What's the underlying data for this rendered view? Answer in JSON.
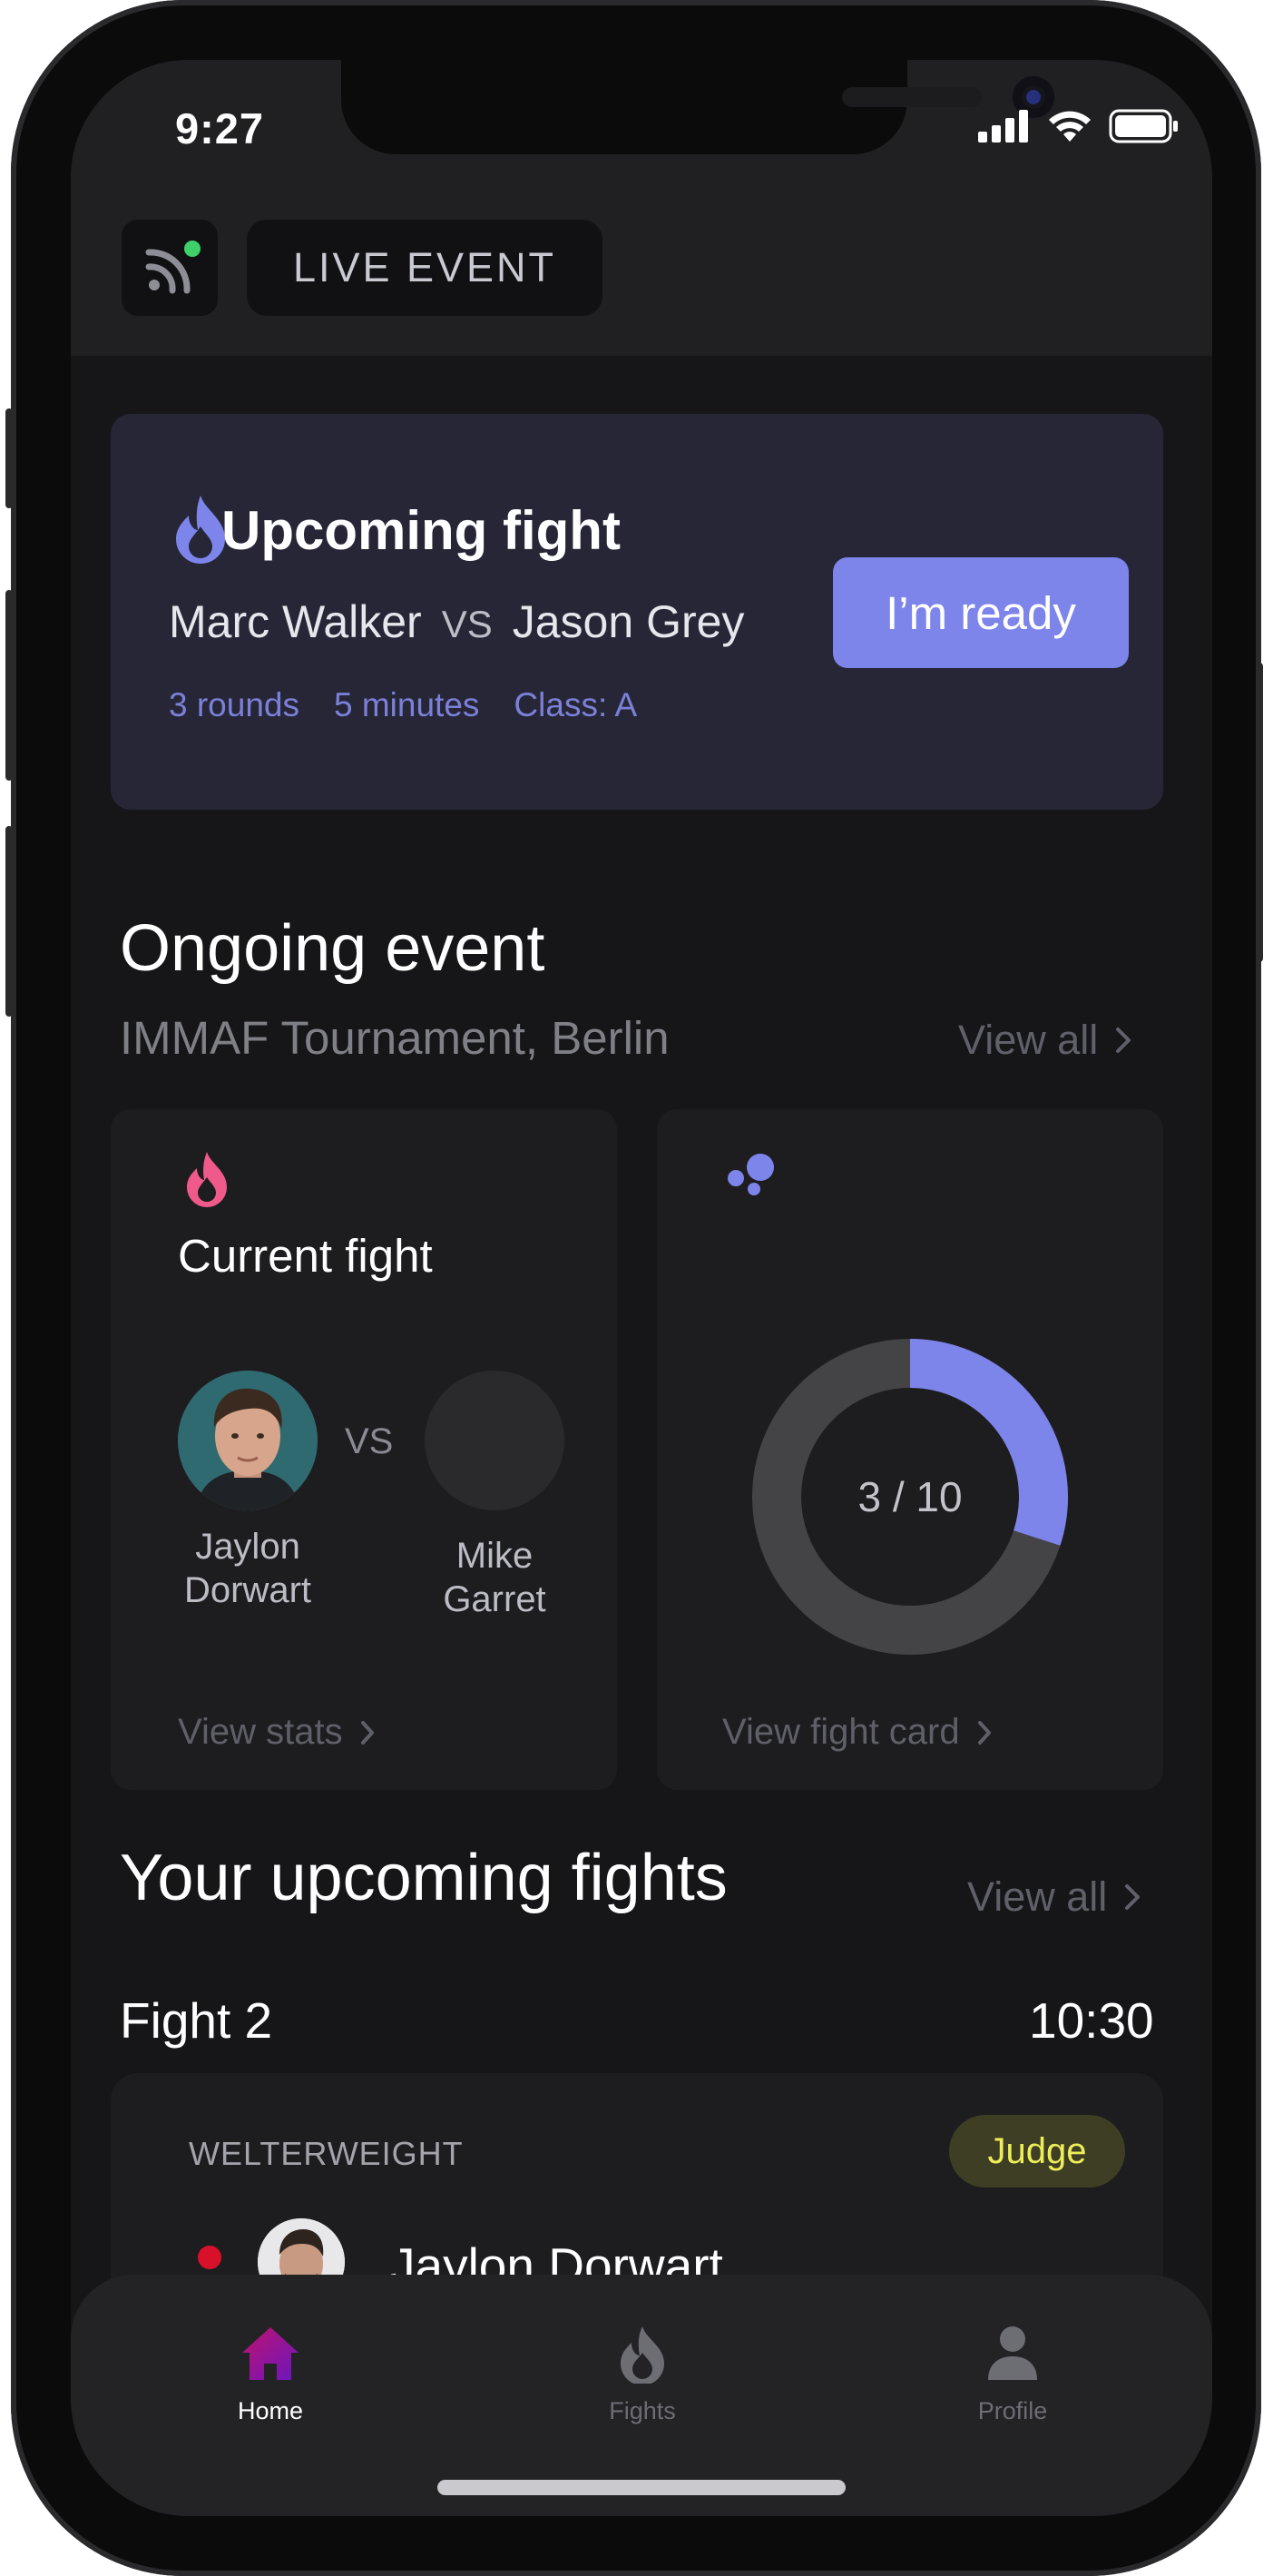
{
  "status": {
    "time": "9:27"
  },
  "header": {
    "live_label": "LIVE EVENT"
  },
  "upcoming": {
    "title": "Upcoming fight",
    "fighter_a": "Marc Walker",
    "vs": "VS",
    "fighter_b": "Jason Grey",
    "rounds": "3 rounds",
    "duration": "5 minutes",
    "class": "Class: A",
    "ready_button": "I’m ready"
  },
  "ongoing": {
    "title": "Ongoing event",
    "subtitle": "IMMAF Tournament, Berlin",
    "view_all": "View all"
  },
  "current_fight": {
    "title": "Current fight",
    "vs": "VS",
    "fighter_a_line1": "Jaylon",
    "fighter_a_line2": "Dorwart",
    "fighter_b_line1": "Mike",
    "fighter_b_line2": "Garret",
    "view_stats": "View stats"
  },
  "fight_card": {
    "progress_label": "3 / 10",
    "current": 3,
    "total": 10,
    "view_link": "View fight card"
  },
  "your_fights": {
    "title": "Your upcoming fights",
    "view_all": "View all",
    "fight_name": "Fight 2",
    "fight_time": "10:30",
    "weight_class": "WELTERWEIGHT",
    "role_badge": "Judge",
    "fighter": "Jaylon Dorwart"
  },
  "tabs": [
    {
      "label": "Home",
      "icon": "home-icon",
      "active": true
    },
    {
      "label": "Fights",
      "icon": "flame-icon",
      "active": false
    },
    {
      "label": "Profile",
      "icon": "person-icon",
      "active": false
    }
  ],
  "colors": {
    "accent": "#7d84ea",
    "donut_track": "#444447",
    "live_dot": "#3fd06a",
    "flame_pink": "#ef5a8a",
    "judge_text": "#eded5a"
  }
}
